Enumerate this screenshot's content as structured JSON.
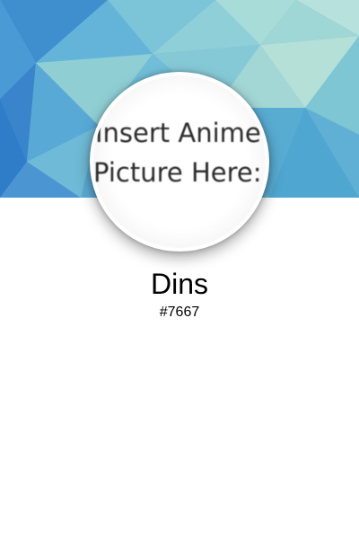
{
  "profile": {
    "avatar_text": {
      "line1": "Insert Anime",
      "line2": "Picture Here:"
    },
    "username": "Dins",
    "discriminator": "#7667"
  },
  "colors": {
    "banner_primary": "#5cb0d6",
    "banner_secondary": "#9fd4d6",
    "background": "#ffffff",
    "text": "#000000"
  }
}
